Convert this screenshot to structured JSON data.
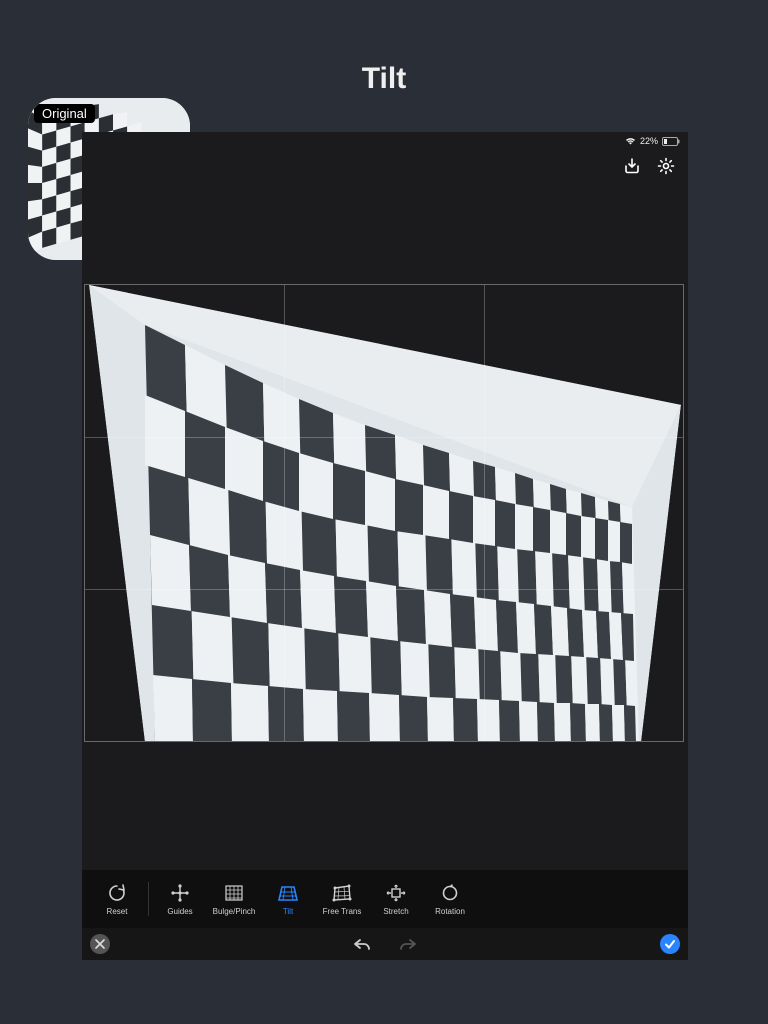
{
  "page_title": "Tilt",
  "original_label": "Original",
  "status": {
    "battery_pct": "22%"
  },
  "toolbar": {
    "reset": "Reset",
    "guides": "Guides",
    "bulge_pinch": "Bulge/Pinch",
    "tilt": "Tilt",
    "free_trans": "Free Trans",
    "stretch": "Stretch",
    "rotation": "Rotation"
  },
  "accent_color": "#2a84ff",
  "icons": {
    "download": "download-icon",
    "settings": "gear-icon",
    "wifi": "wifi-icon",
    "battery": "battery-icon",
    "close": "close-icon",
    "undo": "undo-icon",
    "redo": "redo-icon",
    "check": "check-icon"
  }
}
